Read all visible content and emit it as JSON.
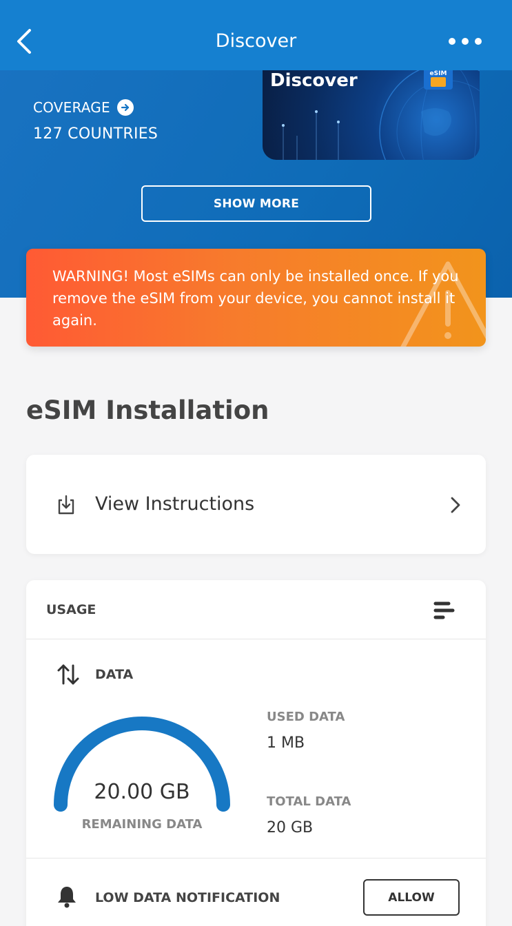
{
  "header": {
    "title": "Discover",
    "back_icon": "chevron-left-icon",
    "more_icon": "more-horizontal-icon"
  },
  "coverage": {
    "label": "COVERAGE",
    "value": "127 COUNTRIES"
  },
  "card": {
    "title": "Discover",
    "chip_label": "eSIM"
  },
  "show_more_label": "SHOW MORE",
  "warning": {
    "text": "WARNING! Most eSIMs can only be installed once. If you remove the eSIM from your device, you cannot install it again."
  },
  "installation": {
    "section_title": "eSIM Installation",
    "view_instructions": "View Instructions"
  },
  "usage": {
    "title": "USAGE",
    "data_label": "DATA",
    "remaining_value": "20.00 GB",
    "remaining_label": "REMAINING DATA",
    "remaining_fraction": 1.0,
    "used_label": "USED DATA",
    "used_value": "1 MB",
    "total_label": "TOTAL DATA",
    "total_value": "20 GB",
    "notification_label": "LOW DATA NOTIFICATION",
    "allow_label": "ALLOW"
  },
  "colors": {
    "primary": "#1580d0",
    "warning_start": "#ff5a34",
    "warning_end": "#f2941c",
    "gauge": "#1778c4"
  }
}
